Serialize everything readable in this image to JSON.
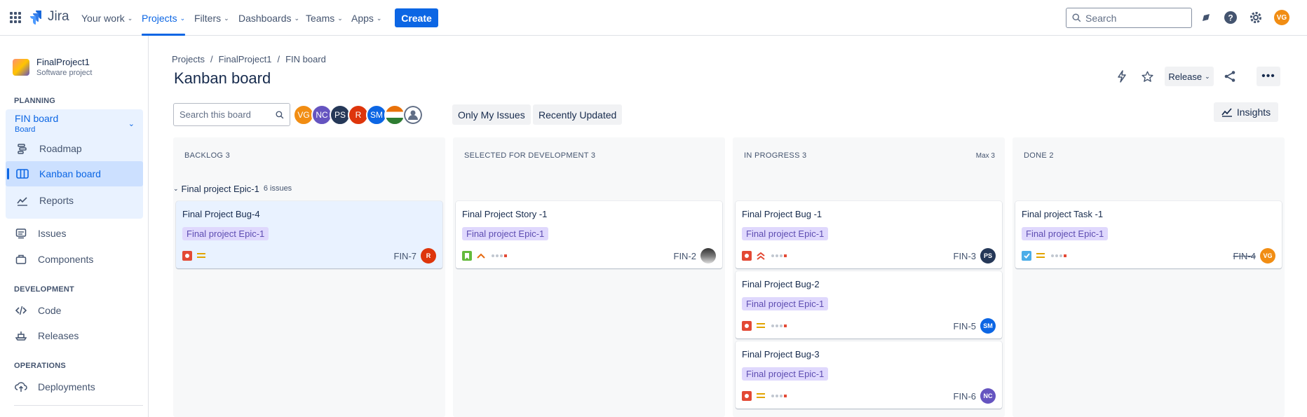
{
  "topnav": {
    "logo_text": "Jira",
    "items": [
      {
        "label": "Your work"
      },
      {
        "label": "Projects"
      },
      {
        "label": "Filters"
      },
      {
        "label": "Dashboards"
      },
      {
        "label": "Teams"
      },
      {
        "label": "Apps"
      }
    ],
    "create_label": "Create",
    "search_placeholder": "Search",
    "user_initials": "VG"
  },
  "sidebar": {
    "project_name": "FinalProject1",
    "project_type": "Software project",
    "planning_label": "PLANNING",
    "board_title": "FIN board",
    "board_subtitle": "Board",
    "planning_items": [
      {
        "label": "Roadmap"
      },
      {
        "label": "Kanban board"
      },
      {
        "label": "Reports"
      }
    ],
    "other_items": [
      {
        "label": "Issues"
      },
      {
        "label": "Components"
      }
    ],
    "development_label": "DEVELOPMENT",
    "development_items": [
      {
        "label": "Code"
      },
      {
        "label": "Releases"
      }
    ],
    "operations_label": "OPERATIONS",
    "operations_items": [
      {
        "label": "Deployments"
      }
    ]
  },
  "main": {
    "breadcrumb": [
      "Projects",
      "/",
      "FinalProject1",
      "/",
      "FIN board"
    ],
    "title": "Kanban board",
    "release_label": "Release",
    "board_search_placeholder": "Search this board",
    "avatars": [
      "VG",
      "NC",
      "PS",
      "R",
      "SM",
      "",
      ""
    ],
    "filter_only_my": "Only My Issues",
    "filter_recent": "Recently Updated",
    "insights_label": "Insights"
  },
  "columns": [
    {
      "header": "BACKLOG 3",
      "max": ""
    },
    {
      "header": "SELECTED FOR DEVELOPMENT 3",
      "max": ""
    },
    {
      "header": "IN PROGRESS 3",
      "max": "Max 3"
    },
    {
      "header": "DONE 2",
      "max": ""
    }
  ],
  "swimlane": {
    "title": "Final project Epic-1",
    "count": "6 issues"
  },
  "cards": [
    {
      "title": "Final Project Bug-4",
      "epic": "Final project Epic-1",
      "key": "FIN-7",
      "assignee": "R",
      "type": "bug",
      "priority": "medium"
    },
    {
      "title": "Final Project Story -1",
      "epic": "Final project Epic-1",
      "key": "FIN-2",
      "assignee": "",
      "type": "story",
      "priority": "low"
    },
    {
      "title": "Final Project Bug -1",
      "epic": "Final project Epic-1",
      "key": "FIN-3",
      "assignee": "PS",
      "type": "bug",
      "priority": "highest"
    },
    {
      "title": "Final Project Bug-2",
      "epic": "Final project Epic-1",
      "key": "FIN-5",
      "assignee": "SM",
      "type": "bug",
      "priority": "medium"
    },
    {
      "title": "Final Project Bug-3",
      "epic": "Final project Epic-1",
      "key": "FIN-6",
      "assignee": "NC",
      "type": "bug",
      "priority": "medium"
    },
    {
      "title": "Final project Task -1",
      "epic": "Final project Epic-1",
      "key": "FIN-4",
      "assignee": "VG",
      "type": "task",
      "priority": "medium"
    }
  ],
  "colors": {
    "accent": "#0c66e4",
    "epic_bg": "#dfd8fd",
    "epic_text": "#5e4db2",
    "bug": "#e34935",
    "story": "#63ba3c",
    "task": "#4bade8"
  }
}
